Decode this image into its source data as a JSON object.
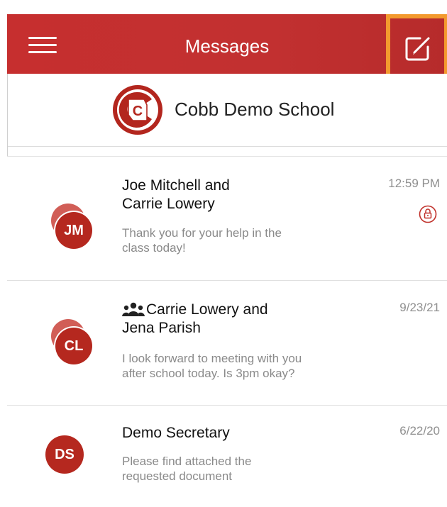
{
  "header": {
    "title": "Messages",
    "menu_icon": "hamburger-menu-icon",
    "compose_icon": "compose-icon",
    "accent_color": "#c62f2f",
    "highlight_color": "#f39a2e"
  },
  "school": {
    "name": "Cobb Demo School",
    "logo_letter": "C"
  },
  "messages": [
    {
      "initials": "JM",
      "title_line1": "Joe Mitchell and",
      "title_line2": "Carrie Lowery",
      "preview_line1": "Thank you for your help in the",
      "preview_line2": "class today!",
      "time": "12:59 PM",
      "locked": true,
      "group": false
    },
    {
      "initials": "CL",
      "title_line1": "Carrie Lowery and",
      "title_line2": "Jena Parish",
      "preview_line1": "I look forward to meeting with you",
      "preview_line2": "after school today. Is 3pm okay?",
      "time": "9/23/21",
      "locked": false,
      "group": true
    },
    {
      "initials": "DS",
      "title_line1": "Demo Secretary",
      "preview_line1": "Please find attached the",
      "preview_line2": "requested document",
      "time": "6/22/20",
      "locked": false,
      "group": false
    }
  ]
}
